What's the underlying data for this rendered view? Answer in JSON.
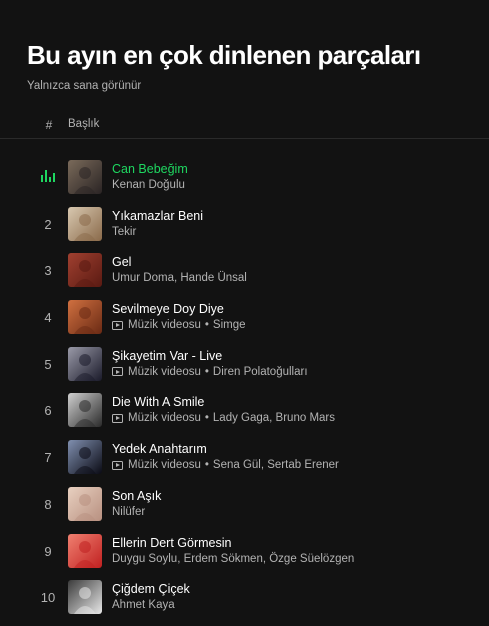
{
  "page": {
    "title": "Bu ayın en çok dinlenen parçaları",
    "subtitle": "Yalnızca sana görünür"
  },
  "table_header": {
    "number": "#",
    "title": "Başlık"
  },
  "tracks": [
    {
      "rank": "1",
      "title": "Can Bebeğim",
      "artists": "Kenan Doğulu",
      "is_video": false,
      "playing": true,
      "thumb": [
        "#2a2424",
        "#7a6a5a"
      ]
    },
    {
      "rank": "2",
      "title": "Yıkamazlar Beni",
      "artists": "Tekir",
      "is_video": false,
      "playing": false,
      "thumb": [
        "#8a6a4a",
        "#d8c8b0"
      ]
    },
    {
      "rank": "3",
      "title": "Gel",
      "artists": "Umur Doma, Hande Ünsal",
      "is_video": false,
      "playing": false,
      "thumb": [
        "#5a1a12",
        "#a04030"
      ]
    },
    {
      "rank": "4",
      "title": "Sevilmeye Doy Diye",
      "artists": "Simge",
      "is_video": true,
      "video_label": "Müzik videosu",
      "playing": false,
      "thumb": [
        "#6a2a14",
        "#d07040"
      ]
    },
    {
      "rank": "5",
      "title": "Şikayetim Var - Live",
      "artists": "Diren Polatoğulları",
      "is_video": true,
      "video_label": "Müzik videosu",
      "playing": false,
      "thumb": [
        "#1a1a2a",
        "#9a9aa8"
      ]
    },
    {
      "rank": "6",
      "title": "Die With A Smile",
      "artists": "Lady Gaga, Bruno Mars",
      "is_video": true,
      "video_label": "Müzik videosu",
      "playing": false,
      "thumb": [
        "#2a2a2a",
        "#d0d0d0"
      ]
    },
    {
      "rank": "7",
      "title": "Yedek Anahtarım",
      "artists": "Sena Gül, Sertab Erener",
      "is_video": true,
      "video_label": "Müzik videosu",
      "playing": false,
      "thumb": [
        "#0a0a14",
        "#8090b0"
      ]
    },
    {
      "rank": "8",
      "title": "Son Aşık",
      "artists": "Nilüfer",
      "is_video": false,
      "playing": false,
      "thumb": [
        "#b89080",
        "#e8d0c0"
      ]
    },
    {
      "rank": "9",
      "title": "Ellerin Dert Görmesin",
      "artists": "Duygu Soylu, Erdem Sökmen, Özge Süelözgen",
      "is_video": false,
      "playing": false,
      "thumb": [
        "#c02020",
        "#f08070"
      ]
    },
    {
      "rank": "10",
      "title": "Çiğdem Çiçek",
      "artists": "Ahmet Kaya",
      "is_video": false,
      "playing": false,
      "thumb": [
        "#e8e8e8",
        "#3a3a3a"
      ]
    }
  ],
  "colors": {
    "background": "#121212",
    "accent_green": "#1ed760",
    "secondary_text": "#b3b3b3"
  }
}
